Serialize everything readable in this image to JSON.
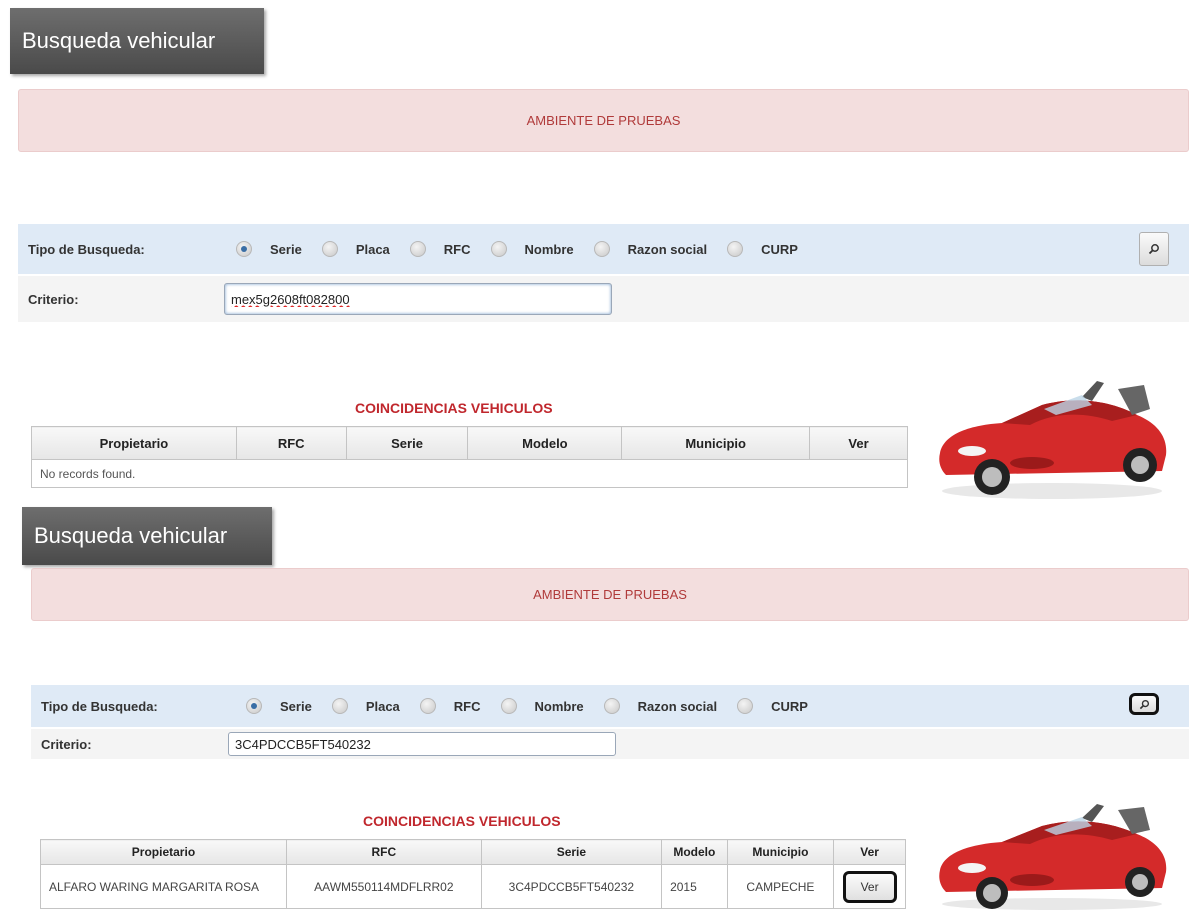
{
  "screen1": {
    "title": "Busqueda vehicular",
    "environment_banner": "AMBIENTE DE PRUEBAS",
    "search": {
      "type_label": "Tipo de Busqueda:",
      "options": [
        "Serie",
        "Placa",
        "RFC",
        "Nombre",
        "Razon social",
        "CURP"
      ],
      "selected": "Serie",
      "button_icon": "search-icon"
    },
    "criteria": {
      "label": "Criterio:",
      "value": "mex5g2608ft082800"
    },
    "results": {
      "title": "COINCIDENCIAS VEHICULOS",
      "columns": [
        "Propietario",
        "RFC",
        "Serie",
        "Modelo",
        "Municipio",
        "Ver"
      ],
      "empty_message": "No records found."
    }
  },
  "screen2": {
    "title": "Busqueda vehicular",
    "environment_banner": "AMBIENTE DE PRUEBAS",
    "search": {
      "type_label": "Tipo de Busqueda:",
      "options": [
        "Serie",
        "Placa",
        "RFC",
        "Nombre",
        "Razon social",
        "CURP"
      ],
      "selected": "Serie",
      "button_icon": "search-icon"
    },
    "criteria": {
      "label": "Criterio:",
      "value": "3C4PDCCB5FT540232"
    },
    "results": {
      "title": "COINCIDENCIAS VEHICULOS",
      "columns": [
        "Propietario",
        "RFC",
        "Serie",
        "Modelo",
        "Municipio",
        "Ver"
      ],
      "rows": [
        {
          "propietario": "ALFARO WARING MARGARITA ROSA",
          "rfc": "AAWM550114MDFLRR02",
          "serie": "3C4PDCCB5FT540232",
          "modelo": "2015",
          "municipio": "CAMPECHE",
          "ver": "Ver"
        }
      ]
    }
  },
  "colors": {
    "banner_bg": "#f3dede",
    "banner_text": "#b03a3a",
    "results_title": "#c0272d",
    "search_row_bg": "#dfeaf6",
    "car_red": "#d42a2a"
  }
}
